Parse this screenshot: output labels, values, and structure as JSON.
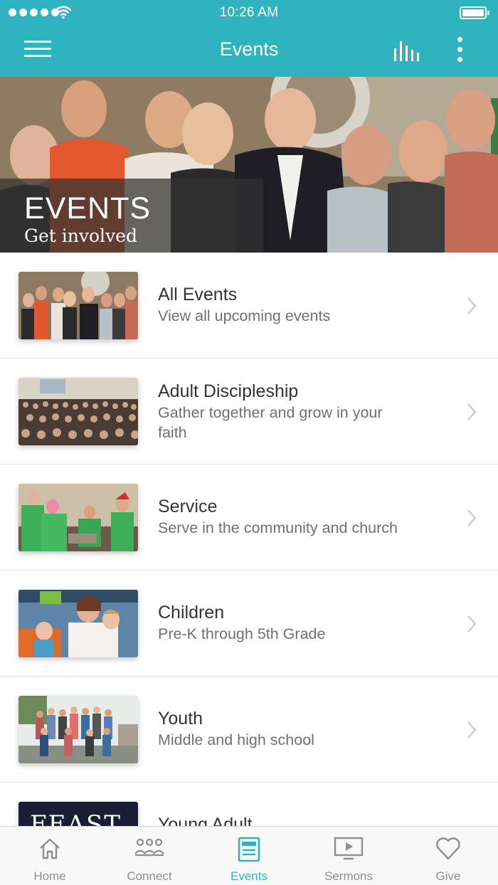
{
  "status_bar": {
    "time": "10:26 AM"
  },
  "header": {
    "title": "Events"
  },
  "hero": {
    "title": "EVENTS",
    "subtitle": "Get involved"
  },
  "items": [
    {
      "title": "All Events",
      "subtitle": "View all upcoming events",
      "thumb": "group-photo"
    },
    {
      "title": "Adult Discipleship",
      "subtitle": "Gather together and grow in your faith",
      "thumb": "congregation-photo"
    },
    {
      "title": "Service",
      "subtitle": "Serve in the community and church",
      "thumb": "volunteers-photo"
    },
    {
      "title": "Children",
      "subtitle": "Pre-K through 5th Grade",
      "thumb": "children-photo"
    },
    {
      "title": "Youth",
      "subtitle": "Middle and high school",
      "thumb": "youth-group-photo"
    },
    {
      "title": "Young Adult",
      "subtitle": "",
      "thumb": "feast-photo",
      "thumb_text": "FEAST"
    }
  ],
  "tabs": [
    {
      "label": "Home",
      "icon": "home-icon"
    },
    {
      "label": "Connect",
      "icon": "people-icon"
    },
    {
      "label": "Events",
      "icon": "calendar-icon",
      "active": true
    },
    {
      "label": "Sermons",
      "icon": "video-icon"
    },
    {
      "label": "Give",
      "icon": "heart-icon"
    }
  ],
  "colors": {
    "accent": "#2fb3bf",
    "tab_inactive": "#8e8e8e",
    "text_primary": "#333333",
    "text_secondary": "#707070"
  }
}
